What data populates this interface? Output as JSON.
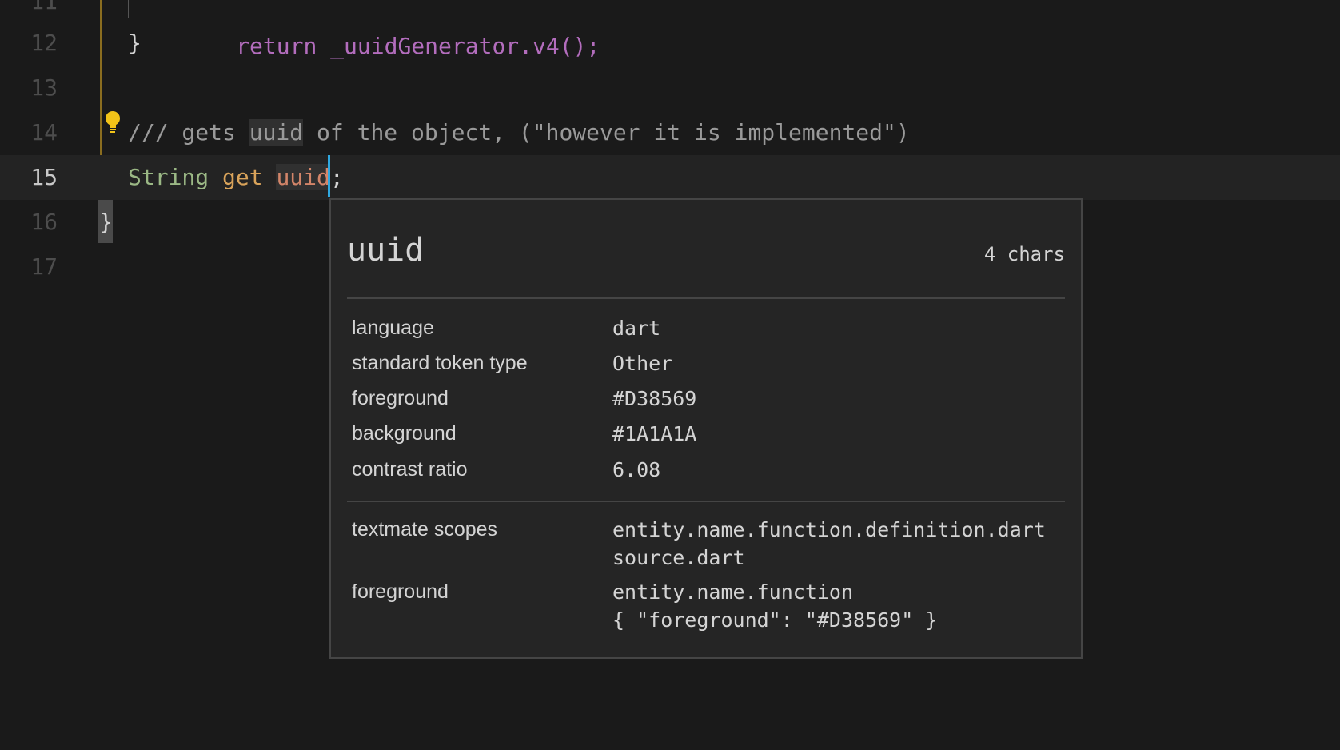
{
  "editor": {
    "lines": [
      {
        "num": "11",
        "text": "return _uuidGenerator.v4();"
      },
      {
        "num": "12",
        "text": "}"
      },
      {
        "num": "13",
        "text": ""
      },
      {
        "num": "14",
        "comment_prefix": "/// gets ",
        "comment_word": "uuid",
        "comment_suffix": " of the object, (\"however it is implemented\")"
      },
      {
        "num": "15",
        "type_kw": "String",
        "get_kw": "get",
        "name": "uuid",
        "semicolon": ";"
      },
      {
        "num": "16",
        "text": "}"
      },
      {
        "num": "17",
        "text": ""
      }
    ],
    "lightbulb_icon": "lightbulb-icon",
    "colors": {
      "background": "#1A1A1A",
      "function_name": "#D38569",
      "caret": "#2FA8E0",
      "lightbulb": "#F2C318"
    }
  },
  "inspector": {
    "token": "uuid",
    "length_label": "4 chars",
    "rows": [
      {
        "label": "language",
        "value": "dart"
      },
      {
        "label": "standard token type",
        "value": "Other"
      },
      {
        "label": "foreground",
        "value": "#D38569"
      },
      {
        "label": "background",
        "value": "#1A1A1A"
      },
      {
        "label": "contrast ratio",
        "value": "6.08"
      }
    ],
    "scopes_label": "textmate scopes",
    "scopes": [
      "entity.name.function.definition.dart",
      "source.dart"
    ],
    "theme_rule_label": "foreground",
    "theme_rule_selector": "entity.name.function",
    "theme_rule_value": "{ \"foreground\": \"#D38569\" }"
  }
}
